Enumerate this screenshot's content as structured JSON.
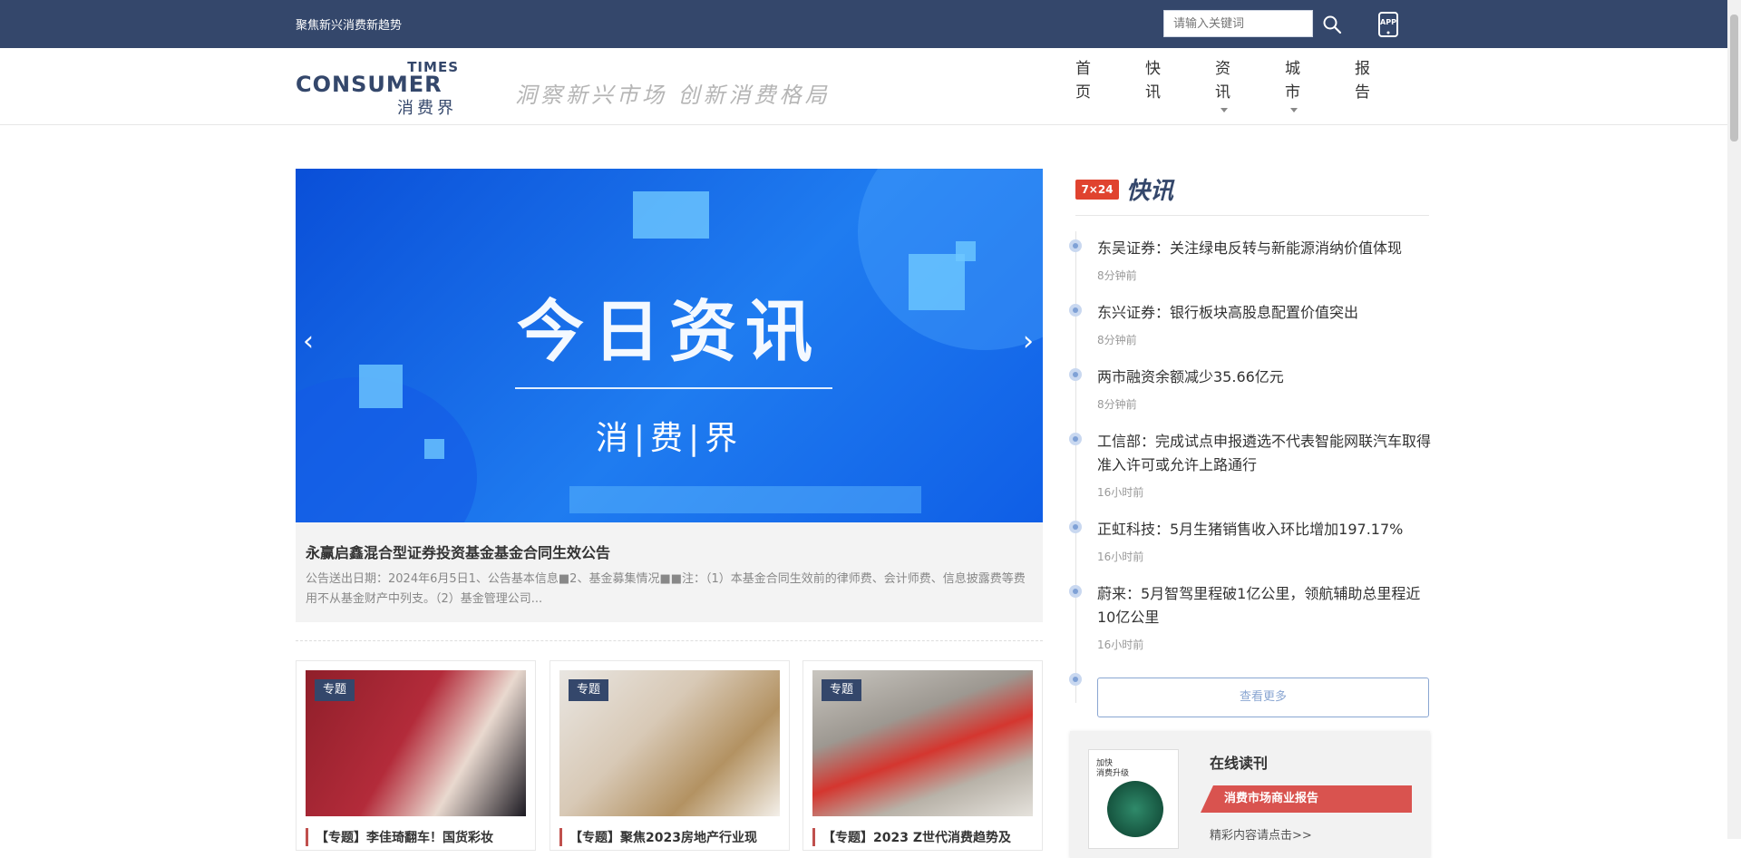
{
  "topbar": {
    "slogan": "聚焦新兴消费新趋势",
    "search_placeholder": "请输入关键词",
    "search_icon": "search-icon",
    "app_icon": "app-download-icon",
    "app_label": "APP"
  },
  "header": {
    "logo": {
      "line1": "TIMES",
      "line2": "CONSUMER",
      "line3": "消费界"
    },
    "motto": "洞察新兴市场 创新消费格局",
    "nav": [
      {
        "line1": "首",
        "line2": "页",
        "has_dropdown": false
      },
      {
        "line1": "快",
        "line2": "讯",
        "has_dropdown": false
      },
      {
        "line1": "资",
        "line2": "讯",
        "has_dropdown": true
      },
      {
        "line1": "城",
        "line2": "市",
        "has_dropdown": true
      },
      {
        "line1": "报",
        "line2": "告",
        "has_dropdown": false
      }
    ]
  },
  "banner": {
    "title": "今日资讯",
    "subtitle": "消|费|界",
    "prev": "‹",
    "next": "›",
    "caption_title": "永赢启鑫混合型证券投资基金基金合同生效公告",
    "caption_desc": "公告送出日期：2024年6月5日1、公告基本信息■2、基金募集情况■■注：（1）本基金合同生效前的律师费、会计师费、信息披露费等费用不从基金财产中列支。（2）基金管理公司..."
  },
  "cards": [
    {
      "tag": "专题",
      "title": "【专题】李佳琦翻车！国货彩妆"
    },
    {
      "tag": "专题",
      "title": "【专题】聚焦2023房地产行业现"
    },
    {
      "tag": "专题",
      "title": "【专题】2023 Z世代消费趋势及"
    }
  ],
  "news": {
    "badge": "7×24",
    "heading": "快讯",
    "items": [
      {
        "title": "东吴证券：关注绿电反转与新能源消纳价值体现",
        "time": "8分钟前"
      },
      {
        "title": "东兴证券：银行板块高股息配置价值突出",
        "time": "8分钟前"
      },
      {
        "title": "两市融资余额减少35.66亿元",
        "time": "8分钟前"
      },
      {
        "title": "工信部：完成试点申报遴选不代表智能网联汽车取得准入许可或允许上路通行",
        "time": "16小时前"
      },
      {
        "title": "正虹科技：5月生猪销售收入环比增加197.17%",
        "time": "16小时前"
      },
      {
        "title": "蔚来：5月智驾里程破1亿公里，领航辅助总里程近10亿公里",
        "time": "16小时前"
      }
    ],
    "more": "查看更多"
  },
  "magazine": {
    "title": "在线读刊",
    "ribbon": "消费市场商业报告",
    "link": "精彩内容请点击>>",
    "cover_text": "加快\n消费升级"
  },
  "colors": {
    "navy": "#34476b",
    "accent_red": "#d9534f",
    "timeline_dot": "#7fa1d6"
  }
}
